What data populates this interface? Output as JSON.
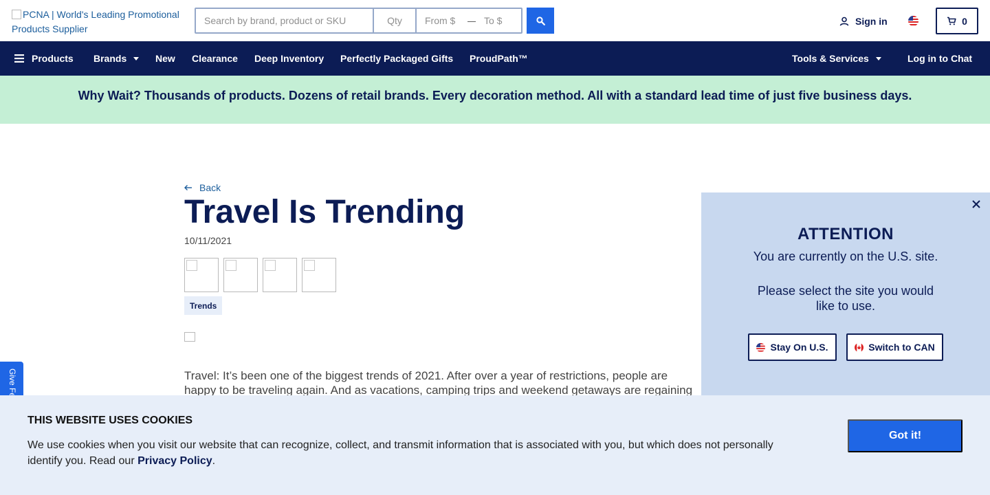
{
  "header": {
    "logo_alt": "PCNA | World's Leading Promotional Products Supplier",
    "search": {
      "placeholder": "Search by brand, product or SKU",
      "qty_placeholder": "Qty",
      "price_from_placeholder": "From $",
      "price_dash": "—",
      "price_to_placeholder": "To $"
    },
    "signin_label": "Sign in",
    "cart_count": "0"
  },
  "nav": {
    "items": [
      "Products",
      "Brands",
      "New",
      "Clearance",
      "Deep Inventory",
      "Perfectly Packaged Gifts",
      "ProudPath™"
    ],
    "tools_label": "Tools & Services",
    "chat_label": "Log in to Chat"
  },
  "banner": {
    "text": "Why Wait? Thousands of products. Dozens of retail brands. Every decoration method. All with a standard lead time of just five business days."
  },
  "article": {
    "back_label": "Back",
    "title": "Travel Is Trending",
    "date": "10/11/2021",
    "tag": "Trends",
    "body": "Travel: It’s been one of the biggest trends of 2021. After over a year of restrictions, people are happy to be traveling again. And as vacations, camping trips and weekend getaways are regaining popularity, products"
  },
  "feedback": {
    "label": "Give Feedback"
  },
  "site_modal": {
    "heading": "ATTENTION",
    "line1": "You are currently on the U.S. site.",
    "line2": "Please select the site you would like to use.",
    "stay_label": "Stay On U.S.",
    "switch_label": "Switch to CAN"
  },
  "cookie": {
    "title": "THIS WEBSITE USES COOKIES",
    "text": "We use cookies when you visit our website that can recognize, collect, and transmit information that is associated with you, but which does not personally identify you. Read our",
    "link": "Privacy Policy",
    "period": ".",
    "button": "Got it!"
  },
  "colors": {
    "navy": "#0c1c55",
    "accent_blue": "#1f66e5",
    "banner_green": "#c4efd5",
    "modal_bg": "#c8d8ef",
    "cookie_bg": "#e7eef9"
  }
}
